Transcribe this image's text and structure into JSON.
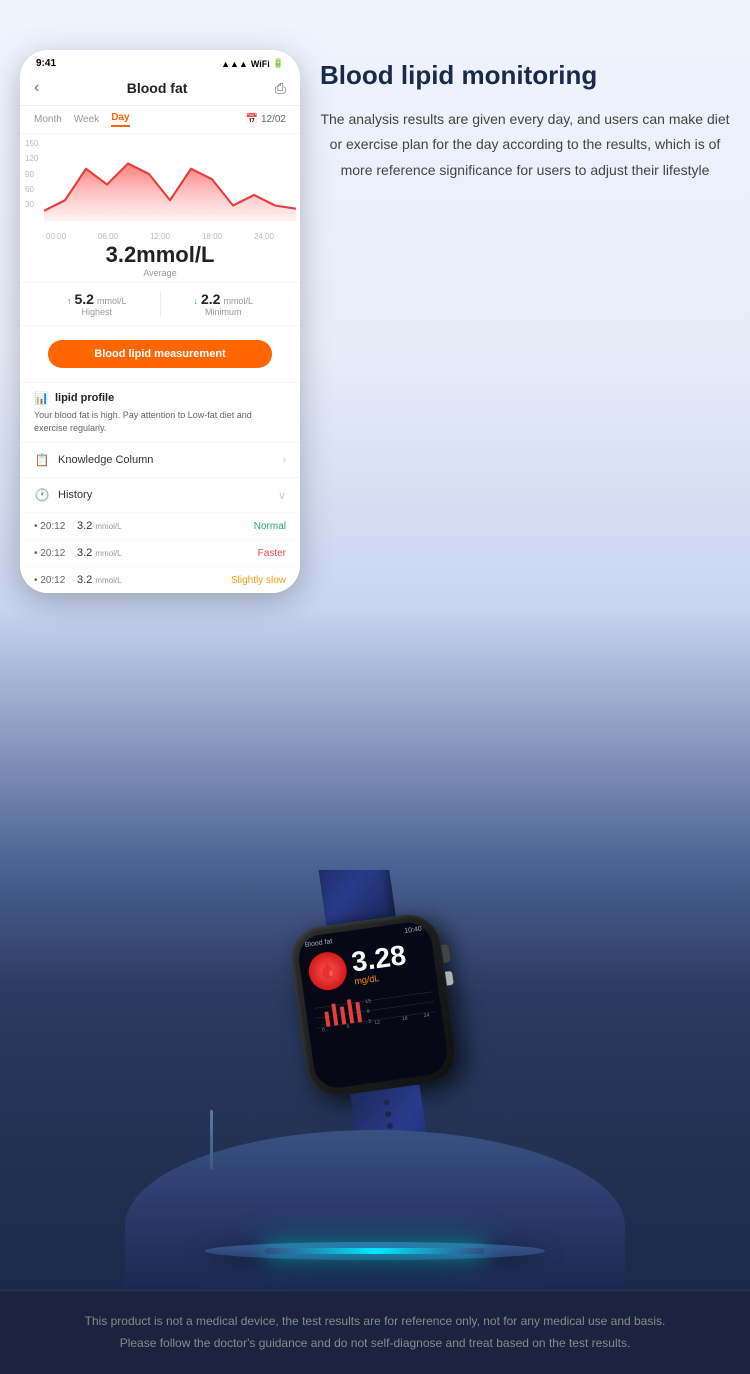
{
  "page": {
    "background_color": "#1a2a4a"
  },
  "feature": {
    "title": "Blood lipid monitoring",
    "description": "The analysis results are given every day, and users can make diet or exercise plan for the day according to the results, which is of more reference significance for users to adjust their lifestyle"
  },
  "phone": {
    "status_bar": {
      "time": "9:41",
      "signal": "●●●",
      "wifi": "WiFi",
      "battery": "■"
    },
    "header": {
      "back": "‹",
      "title": "Blood fat",
      "share": "⎙"
    },
    "tabs": {
      "month": "Month",
      "week": "Week",
      "day": "Day",
      "date": "12/02"
    },
    "chart": {
      "y_labels": [
        "150",
        "120",
        "90",
        "60",
        "30"
      ],
      "x_labels": [
        "00:00",
        "06:00",
        "12:00",
        "18:00",
        "24:00"
      ]
    },
    "main_stat": {
      "value": "3.2mmol/L",
      "label": "Average"
    },
    "sub_stats": {
      "highest": {
        "value": "5.2mmol/L",
        "label": "Highest"
      },
      "minimum": {
        "value": "2.2mmol/L",
        "label": "Minimum"
      }
    },
    "measure_button": "Blood lipid measurement",
    "lipid_profile": {
      "title": "lipid profile",
      "description": "Your blood fat is high. Pay attention to Low-fat diet and exercise regularly."
    },
    "knowledge": {
      "label": "Knowledge Column"
    },
    "history": {
      "label": "History",
      "items": [
        {
          "time": "• 20:12",
          "value": "3.2",
          "unit": "mmol/L",
          "status": "Normal",
          "status_color": "normal"
        },
        {
          "time": "• 20:12",
          "value": "3.2",
          "unit": "mmol/L",
          "status": "Faster",
          "status_color": "faster"
        },
        {
          "time": "• 20:12",
          "value": "3.2",
          "unit": "mmol/L",
          "status": "Slightly slow",
          "status_color": "slow"
        }
      ]
    }
  },
  "watch": {
    "screen": {
      "label": "Blood fat",
      "time": "10:40",
      "value": "3.28",
      "unit": "mg/dL"
    }
  },
  "disclaimer": {
    "line1": "This product is not a medical device, the test results are for reference only, not for any medical use and basis.",
    "line2": "Please follow the doctor's guidance and do not self-diagnose and treat based on the test results."
  }
}
